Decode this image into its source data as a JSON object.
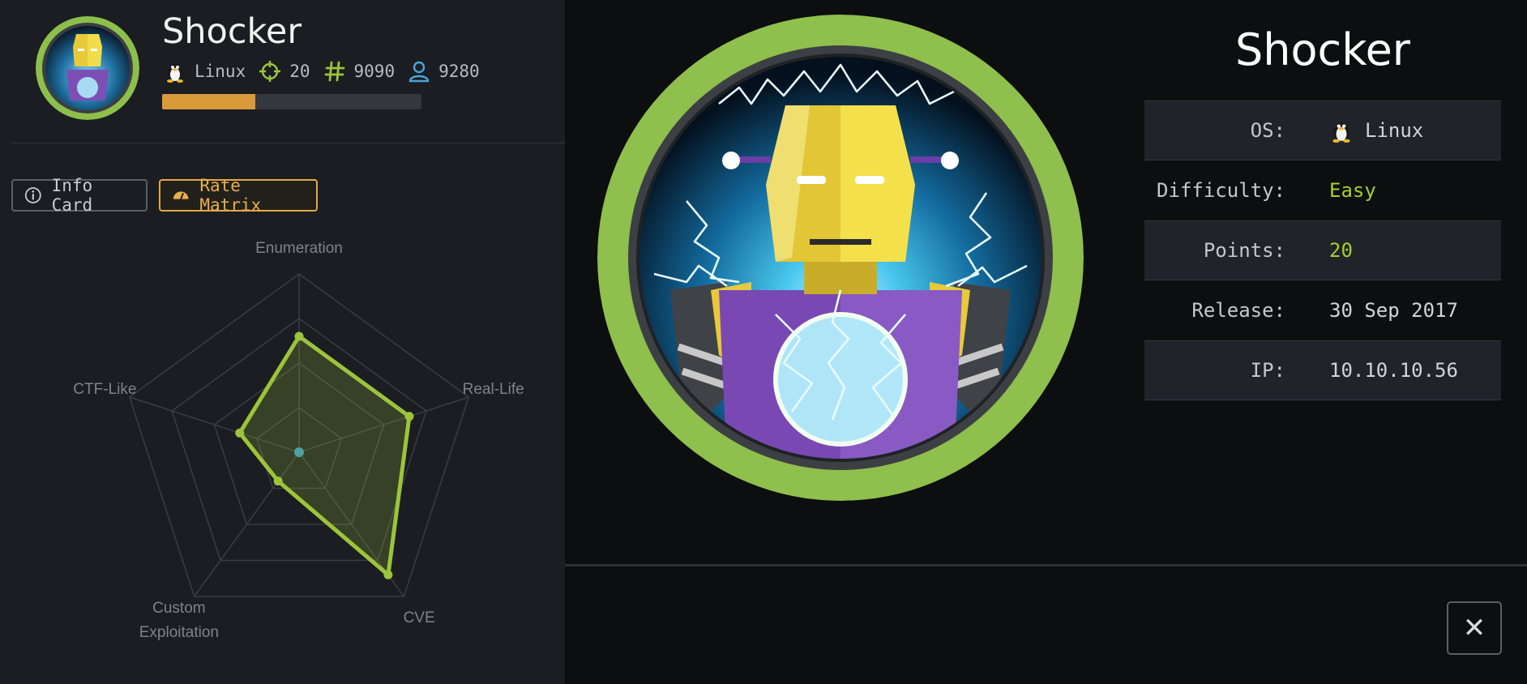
{
  "machine": {
    "name": "Shocker",
    "os": "Linux",
    "points": "20",
    "owns_user": "9090",
    "owns_root": "9280",
    "progress_fraction": 0.36
  },
  "tabs": {
    "info_card": "Info Card",
    "rate_matrix": "Rate Matrix"
  },
  "chart_data": {
    "type": "radar",
    "axes": [
      "Enumeration",
      "Real-Life",
      "CVE",
      "Custom Exploitation",
      "CTF-Like"
    ],
    "axis_label_lines": [
      [
        "Enumeration"
      ],
      [
        "Real-Life"
      ],
      [
        "CVE"
      ],
      [
        "Custom",
        "Exploitation"
      ],
      [
        "CTF-Like"
      ]
    ],
    "values": [
      0.65,
      0.65,
      0.85,
      0.2,
      0.35
    ],
    "range": [
      0,
      1
    ],
    "levels": 4,
    "center_dot": true,
    "series_color": "#9cc43b",
    "grid_color": "#3a3d42"
  },
  "details": {
    "rows": [
      {
        "key": "OS:",
        "value": "Linux",
        "icon": "tux-icon",
        "style": "plain"
      },
      {
        "key": "Difficulty:",
        "value": "Easy",
        "style": "green"
      },
      {
        "key": "Points:",
        "value": "20",
        "style": "green"
      },
      {
        "key": "Release:",
        "value": "30 Sep 2017",
        "style": "plain"
      },
      {
        "key": "IP:",
        "value": "10.10.10.56",
        "style": "plain"
      }
    ]
  },
  "close_label": "✕",
  "colors": {
    "accent_green": "#9cc43b",
    "accent_orange": "#e3a845",
    "accent_blue": "#4aa3d8"
  }
}
